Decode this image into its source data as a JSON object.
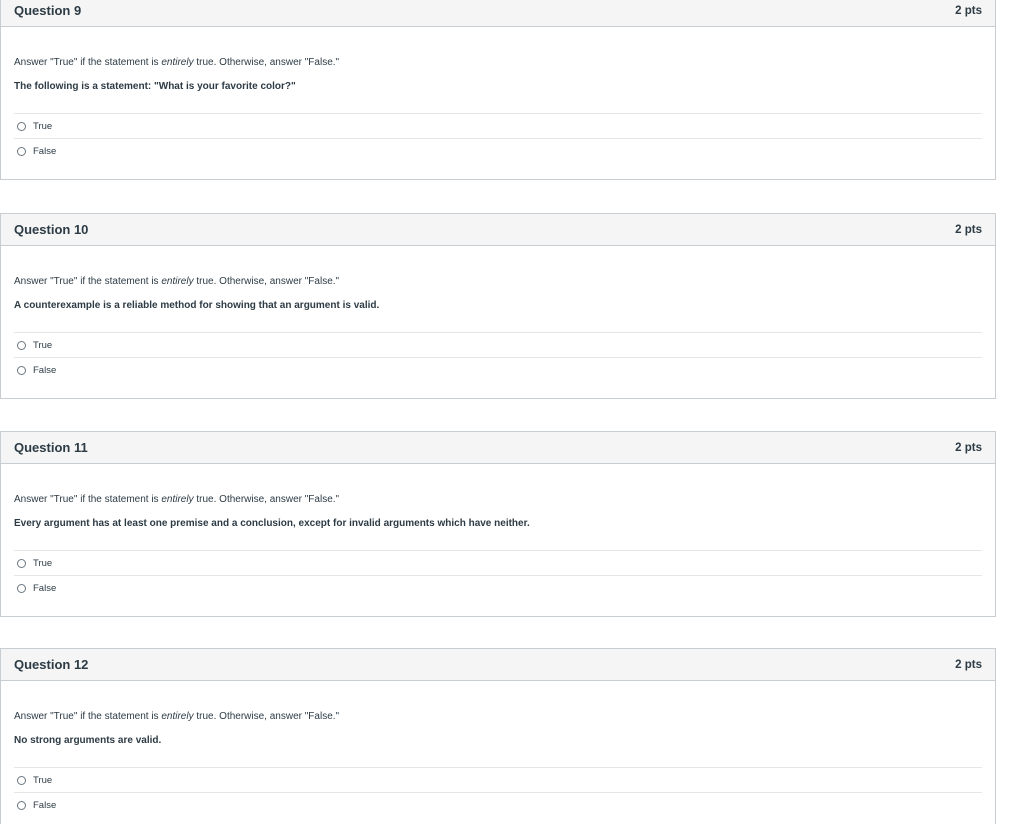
{
  "questions": [
    {
      "title": "Question 9",
      "points": "2 pts",
      "instruction_pre": "Answer \"True\" if the statement is ",
      "instruction_em": "entirely",
      "instruction_post": " true. Otherwise, answer \"False.\"",
      "statement": "The following is a statement:  \"What is your favorite color?\"",
      "answers": [
        "True",
        "False"
      ]
    },
    {
      "title": "Question 10",
      "points": "2 pts",
      "instruction_pre": "Answer \"True\" if the statement is ",
      "instruction_em": "entirely",
      "instruction_post": " true. Otherwise, answer \"False.\"",
      "statement": "A counterexample is a reliable method for showing that an argument is valid.",
      "answers": [
        "True",
        "False"
      ]
    },
    {
      "title": "Question 11",
      "points": "2 pts",
      "instruction_pre": "Answer \"True\" if the statement is ",
      "instruction_em": "entirely",
      "instruction_post": " true. Otherwise, answer \"False.\"",
      "statement": "Every argument has at least one premise and a conclusion, except for invalid arguments which have neither.",
      "answers": [
        "True",
        "False"
      ]
    },
    {
      "title": "Question 12",
      "points": "2 pts",
      "instruction_pre": "Answer \"True\" if the statement is ",
      "instruction_em": "entirely",
      "instruction_post": " true. Otherwise, answer \"False.\"",
      "statement": "No strong arguments are valid.",
      "answers": [
        "True",
        "False"
      ]
    }
  ]
}
